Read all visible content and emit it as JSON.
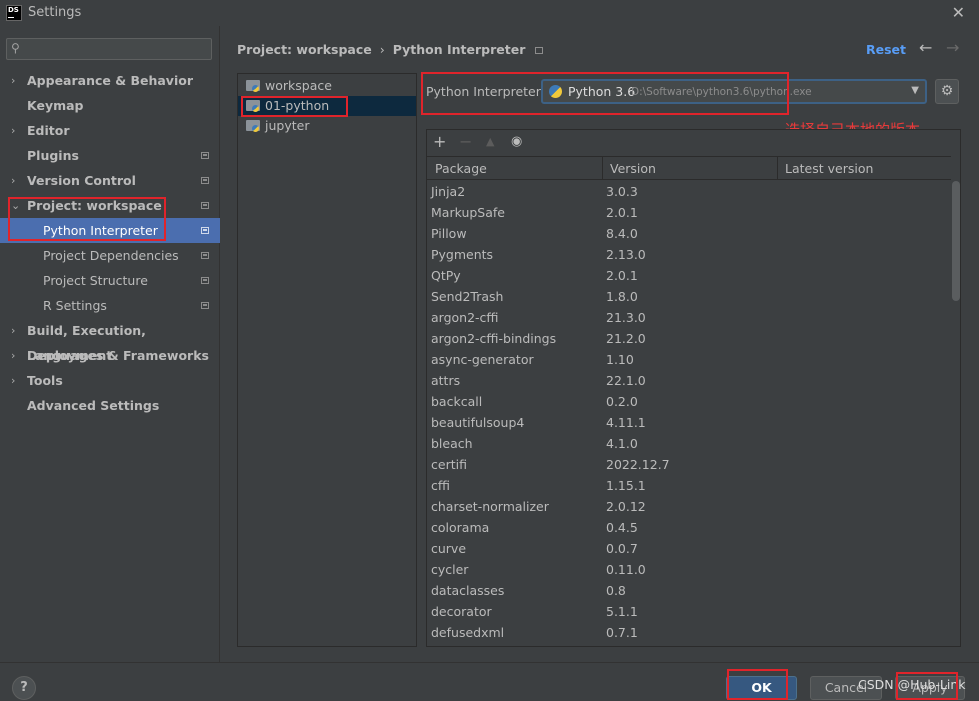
{
  "window": {
    "logo_text": "DS",
    "title": "Settings"
  },
  "sidebar": {
    "search_placeholder": "",
    "items": [
      {
        "label": "Appearance & Behavior",
        "arrow": "›"
      },
      {
        "label": "Keymap"
      },
      {
        "label": "Editor",
        "arrow": "›"
      },
      {
        "label": "Plugins"
      },
      {
        "label": "Version Control",
        "arrow": "›"
      },
      {
        "label": "Project: workspace",
        "arrow": "⌄"
      },
      {
        "label": "Python Interpreter"
      },
      {
        "label": "Project Dependencies"
      },
      {
        "label": "Project Structure"
      },
      {
        "label": "R Settings"
      },
      {
        "label": "Build, Execution, Deployment",
        "arrow": "›"
      },
      {
        "label": "Languages & Frameworks",
        "arrow": "›"
      },
      {
        "label": "Tools",
        "arrow": "›"
      },
      {
        "label": "Advanced Settings"
      }
    ]
  },
  "breadcrumb": {
    "parent": "Project: workspace",
    "separator": "›",
    "current": "Python Interpreter"
  },
  "header": {
    "reset": "Reset",
    "back": "←",
    "forward": "→"
  },
  "project_tree": [
    "workspace",
    "01-python",
    "jupyter"
  ],
  "interpreter": {
    "label": "Python Interpreter:",
    "name": "Python 3.6",
    "path": "D:\\Software\\python3.6\\python.exe",
    "caret": "▼",
    "gear": "⚙"
  },
  "annotation": "选择自己本地的版本",
  "toolbar": {
    "add": "+",
    "remove": "−",
    "up": "▲",
    "eye": "◉"
  },
  "packages": {
    "columns": [
      "Package",
      "Version",
      "Latest version"
    ],
    "rows": [
      [
        "Jinja2",
        "3.0.3",
        ""
      ],
      [
        "MarkupSafe",
        "2.0.1",
        ""
      ],
      [
        "Pillow",
        "8.4.0",
        ""
      ],
      [
        "Pygments",
        "2.13.0",
        ""
      ],
      [
        "QtPy",
        "2.0.1",
        ""
      ],
      [
        "Send2Trash",
        "1.8.0",
        ""
      ],
      [
        "argon2-cffi",
        "21.3.0",
        ""
      ],
      [
        "argon2-cffi-bindings",
        "21.2.0",
        ""
      ],
      [
        "async-generator",
        "1.10",
        ""
      ],
      [
        "attrs",
        "22.1.0",
        ""
      ],
      [
        "backcall",
        "0.2.0",
        ""
      ],
      [
        "beautifulsoup4",
        "4.11.1",
        ""
      ],
      [
        "bleach",
        "4.1.0",
        ""
      ],
      [
        "certifi",
        "2022.12.7",
        ""
      ],
      [
        "cffi",
        "1.15.1",
        ""
      ],
      [
        "charset-normalizer",
        "2.0.12",
        ""
      ],
      [
        "colorama",
        "0.4.5",
        ""
      ],
      [
        "curve",
        "0.0.7",
        ""
      ],
      [
        "cycler",
        "0.11.0",
        ""
      ],
      [
        "dataclasses",
        "0.8",
        ""
      ],
      [
        "decorator",
        "5.1.1",
        ""
      ],
      [
        "defusedxml",
        "0.7.1",
        ""
      ]
    ]
  },
  "buttons": {
    "help": "?",
    "ok": "OK",
    "cancel": "Cancel",
    "apply": "Apply"
  },
  "watermark": "CSDN @Hub-Link"
}
